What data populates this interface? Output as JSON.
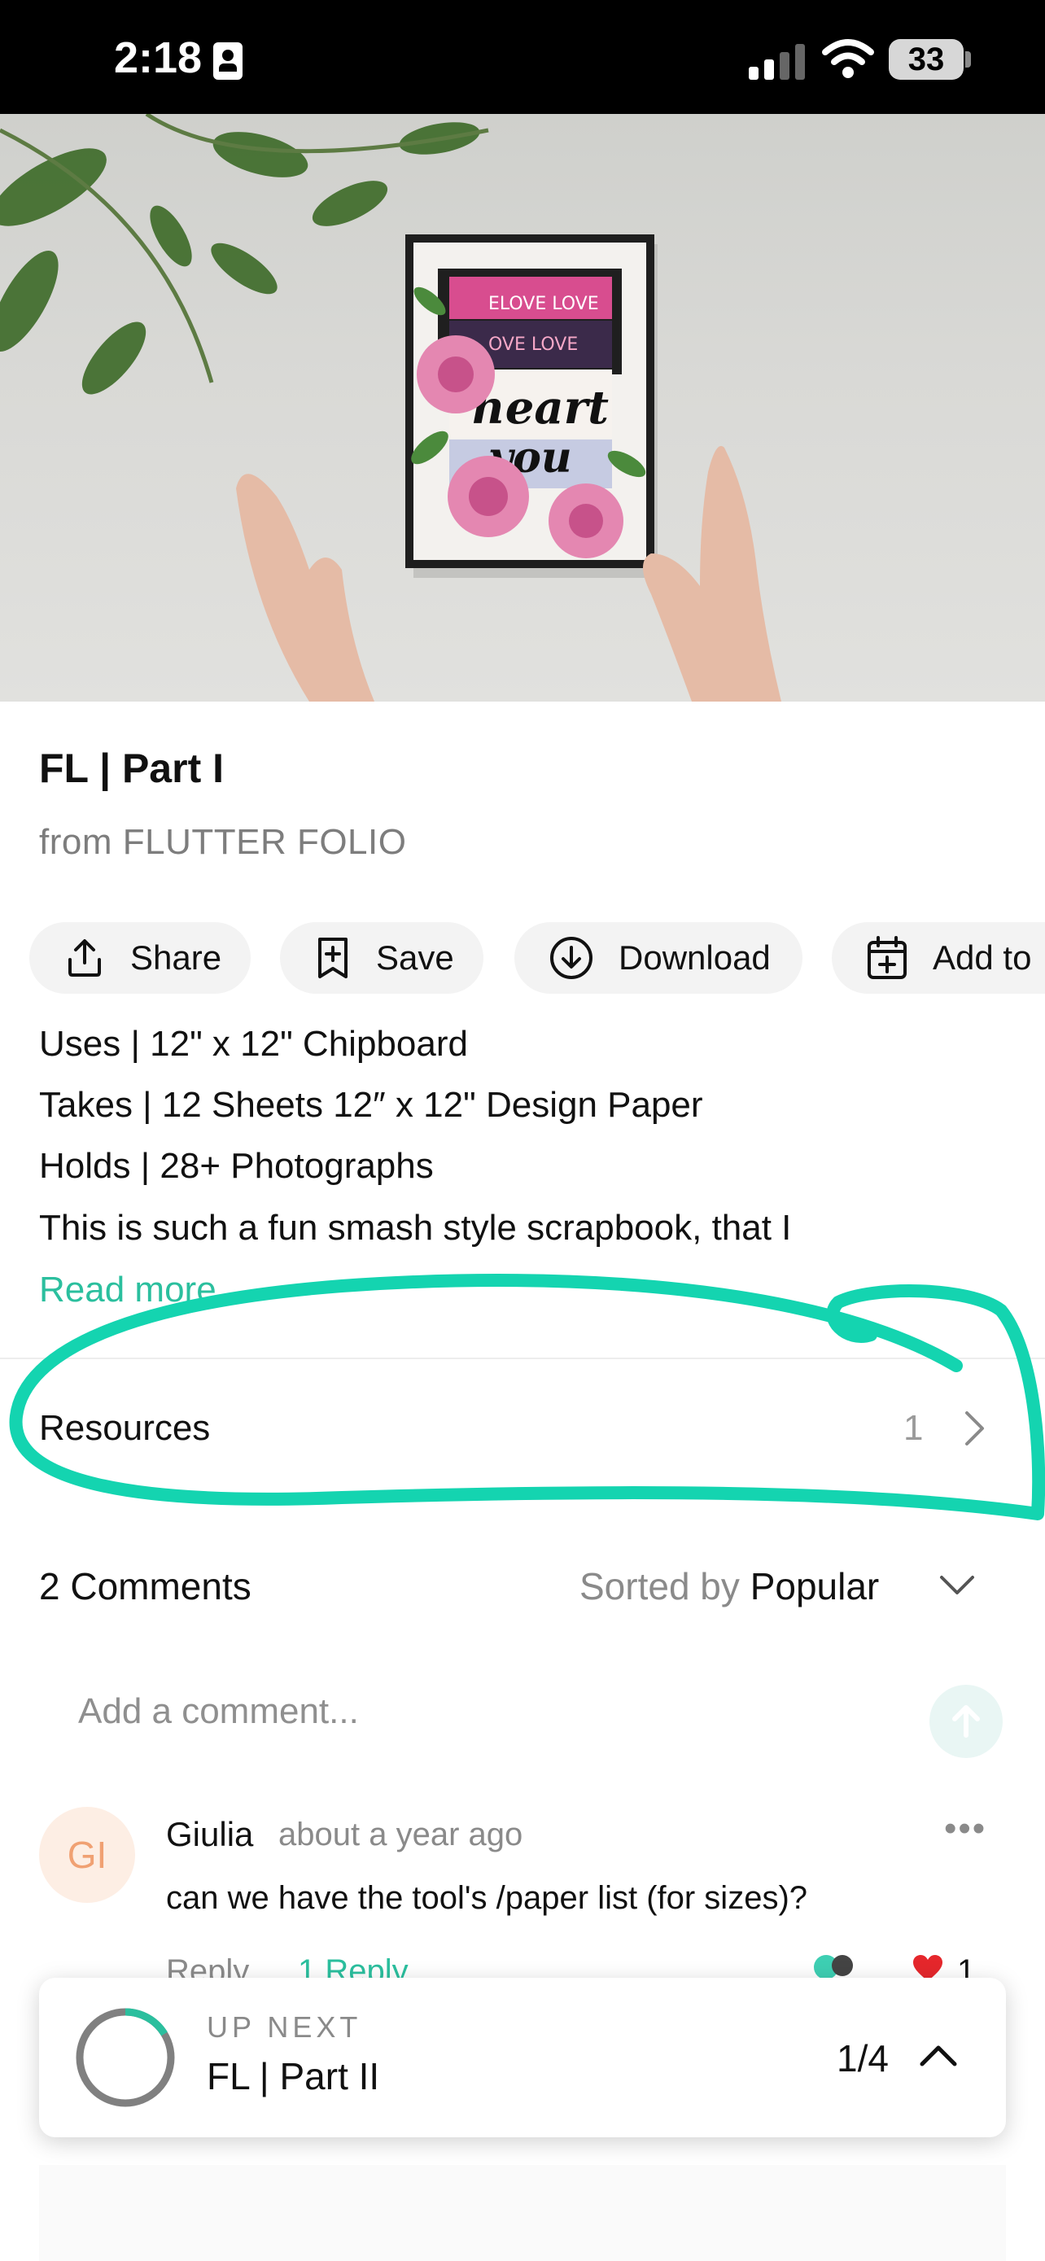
{
  "status_bar": {
    "time": "2:18",
    "battery": "33"
  },
  "video": {
    "title": "FL | Part I",
    "source": "from FLUTTER FOLIO"
  },
  "actions": [
    {
      "label": "Share",
      "icon": "share-icon"
    },
    {
      "label": "Save",
      "icon": "bookmark-add-icon"
    },
    {
      "label": "Download",
      "icon": "download-icon"
    },
    {
      "label": "Add to",
      "icon": "calendar-add-icon"
    }
  ],
  "description": {
    "lines": [
      "Uses | 12\" x 12\" Chipboard",
      "Takes | 12 Sheets 12″ x 12\" Design Paper",
      "Holds | 28+ Photographs",
      "This is such a fun smash style scrapbook, that I"
    ],
    "read_more": "Read more"
  },
  "resources": {
    "label": "Resources",
    "count": "1"
  },
  "comments": {
    "count_label": "2 Comments",
    "sorted_by_label": "Sorted by",
    "sort_value": "Popular",
    "input_placeholder": "Add a comment...",
    "items": [
      {
        "initials": "GI",
        "author": "Giulia",
        "time": "about a year ago",
        "text": "can we have the tool's /paper list (for sizes)?",
        "reply_label": "Reply",
        "replies_label": "1 Reply",
        "likes": "1"
      }
    ]
  },
  "up_next": {
    "label": "UP NEXT",
    "title": "FL | Part II",
    "progress": "1/4"
  },
  "colors": {
    "accent": "#2bbf9e",
    "highlight_marker": "#14d4b0",
    "heart": "#e5272c"
  }
}
